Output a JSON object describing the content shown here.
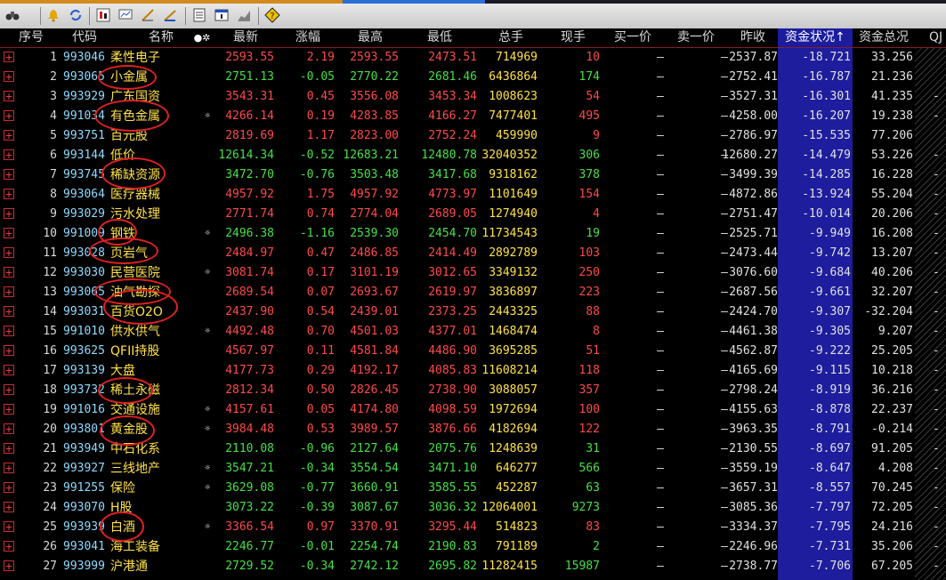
{
  "colors": {
    "accent_select": "#1d1d9e",
    "up": "#ff4a4a",
    "down": "#46e046",
    "name": "#ffe14a",
    "code": "#8fd9ff"
  },
  "toolbar": {
    "icons": [
      "binoculars-icon",
      "alarm-bell-icon",
      "sync-icon",
      "chart-candle-icon",
      "monitor-icon",
      "line-tool-icon",
      "fibonacci-icon",
      "notes-icon",
      "alert-window-icon",
      "trend-chart-icon",
      "help-diamond-icon"
    ]
  },
  "header": {
    "index": "序号",
    "code": "代码",
    "name": "名称",
    "mark": "●✲",
    "last": "最新",
    "chg": "涨幅",
    "high": "最高",
    "low": "最低",
    "vol": "总手",
    "cur": "现手",
    "bid": "买一价",
    "ask": "卖一价",
    "prev": "昨收",
    "fundstatus": "资金状况↑",
    "fundtotal": "资金总况",
    "qj": "QJ"
  },
  "rows": [
    {
      "i": "1",
      "code": "993046",
      "name": "柔性电子",
      "mark": "",
      "last": "2593.55",
      "chg": "2.19",
      "high": "2593.55",
      "low": "2473.51",
      "vol": "714969",
      "cur": "10",
      "bid": "—",
      "ask": "—",
      "prev": "2537.87",
      "fs": "-18.721",
      "ft": "33.256",
      "qj": "",
      "dir": "up"
    },
    {
      "i": "2",
      "code": "993065",
      "name": "小金属",
      "mark": "",
      "last": "2751.13",
      "chg": "-0.05",
      "high": "2770.22",
      "low": "2681.46",
      "vol": "6436864",
      "cur": "174",
      "bid": "—",
      "ask": "—",
      "prev": "2752.41",
      "fs": "-16.787",
      "ft": "21.236",
      "qj": "",
      "dir": "dn"
    },
    {
      "i": "3",
      "code": "993929",
      "name": "广东国资",
      "mark": "",
      "last": "3543.31",
      "chg": "0.45",
      "high": "3556.08",
      "low": "3453.34",
      "vol": "1008623",
      "cur": "54",
      "bid": "—",
      "ask": "—",
      "prev": "3527.31",
      "fs": "-16.301",
      "ft": "41.235",
      "qj": "-",
      "dir": "up"
    },
    {
      "i": "4",
      "code": "991034",
      "name": "有色金属",
      "mark": "☼",
      "last": "4266.14",
      "chg": "0.19",
      "high": "4283.85",
      "low": "4166.27",
      "vol": "7477401",
      "cur": "495",
      "bid": "—",
      "ask": "—",
      "prev": "4258.00",
      "fs": "-16.207",
      "ft": "19.238",
      "qj": "-",
      "dir": "up"
    },
    {
      "i": "5",
      "code": "993751",
      "name": "百元股",
      "mark": "",
      "last": "2819.69",
      "chg": "1.17",
      "high": "2823.00",
      "low": "2752.24",
      "vol": "459990",
      "cur": "9",
      "bid": "—",
      "ask": "—",
      "prev": "2786.97",
      "fs": "-15.535",
      "ft": "77.206",
      "qj": "",
      "dir": "up"
    },
    {
      "i": "6",
      "code": "993144",
      "name": "低价",
      "mark": "",
      "last": "12614.34",
      "chg": "-0.52",
      "high": "12683.21",
      "low": "12480.78",
      "vol": "32040352",
      "cur": "306",
      "bid": "—",
      "ask": "—",
      "prev": "12680.27",
      "fs": "-14.479",
      "ft": "53.226",
      "qj": "-",
      "dir": "dn"
    },
    {
      "i": "7",
      "code": "993745",
      "name": "稀缺资源",
      "mark": "",
      "last": "3472.70",
      "chg": "-0.76",
      "high": "3503.48",
      "low": "3417.68",
      "vol": "9318162",
      "cur": "378",
      "bid": "—",
      "ask": "—",
      "prev": "3499.39",
      "fs": "-14.285",
      "ft": "16.228",
      "qj": "-",
      "dir": "dn"
    },
    {
      "i": "8",
      "code": "993064",
      "name": "医疗器械",
      "mark": "",
      "last": "4957.92",
      "chg": "1.75",
      "high": "4957.92",
      "low": "4773.97",
      "vol": "1101649",
      "cur": "154",
      "bid": "—",
      "ask": "—",
      "prev": "4872.86",
      "fs": "-13.924",
      "ft": "55.204",
      "qj": "-",
      "dir": "up"
    },
    {
      "i": "9",
      "code": "993029",
      "name": "污水处理",
      "mark": "",
      "last": "2771.74",
      "chg": "0.74",
      "high": "2774.04",
      "low": "2689.05",
      "vol": "1274940",
      "cur": "4",
      "bid": "—",
      "ask": "—",
      "prev": "2751.47",
      "fs": "-10.014",
      "ft": "20.206",
      "qj": "-",
      "dir": "up"
    },
    {
      "i": "10",
      "code": "991009",
      "name": "钢铁",
      "mark": "☼",
      "last": "2496.38",
      "chg": "-1.16",
      "high": "2539.30",
      "low": "2454.70",
      "vol": "11734543",
      "cur": "19",
      "bid": "—",
      "ask": "—",
      "prev": "2525.71",
      "fs": "-9.949",
      "ft": "16.208",
      "qj": "-",
      "dir": "dn"
    },
    {
      "i": "11",
      "code": "993028",
      "name": "页岩气",
      "mark": "",
      "last": "2484.97",
      "chg": "0.47",
      "high": "2486.85",
      "low": "2414.49",
      "vol": "2892789",
      "cur": "103",
      "bid": "—",
      "ask": "—",
      "prev": "2473.44",
      "fs": "-9.742",
      "ft": "13.207",
      "qj": "-",
      "dir": "up"
    },
    {
      "i": "12",
      "code": "993030",
      "name": "民营医院",
      "mark": "☼",
      "last": "3081.74",
      "chg": "0.17",
      "high": "3101.19",
      "low": "3012.65",
      "vol": "3349132",
      "cur": "250",
      "bid": "—",
      "ask": "—",
      "prev": "3076.60",
      "fs": "-9.684",
      "ft": "40.206",
      "qj": "-",
      "dir": "up"
    },
    {
      "i": "13",
      "code": "993065",
      "name": "油气勘探",
      "mark": "",
      "last": "2689.54",
      "chg": "0.07",
      "high": "2693.67",
      "low": "2619.97",
      "vol": "3836897",
      "cur": "223",
      "bid": "—",
      "ask": "—",
      "prev": "2687.56",
      "fs": "-9.661",
      "ft": "32.207",
      "qj": "-",
      "dir": "up"
    },
    {
      "i": "14",
      "code": "993031",
      "name": "百货O2O",
      "mark": "",
      "last": "2437.90",
      "chg": "0.54",
      "high": "2439.01",
      "low": "2373.25",
      "vol": "2443325",
      "cur": "88",
      "bid": "—",
      "ask": "—",
      "prev": "2424.70",
      "fs": "-9.307",
      "ft": "-32.204",
      "qj": "-",
      "dir": "up"
    },
    {
      "i": "15",
      "code": "991010",
      "name": "供水供气",
      "mark": "☼",
      "last": "4492.48",
      "chg": "0.70",
      "high": "4501.03",
      "low": "4377.01",
      "vol": "1468474",
      "cur": "8",
      "bid": "—",
      "ask": "—",
      "prev": "4461.38",
      "fs": "-9.305",
      "ft": "9.207",
      "qj": "-",
      "dir": "up"
    },
    {
      "i": "16",
      "code": "993625",
      "name": "QFII持股",
      "mark": "",
      "last": "4567.97",
      "chg": "0.11",
      "high": "4581.84",
      "low": "4486.90",
      "vol": "3695285",
      "cur": "51",
      "bid": "—",
      "ask": "—",
      "prev": "4562.87",
      "fs": "-9.222",
      "ft": "25.205",
      "qj": "-",
      "dir": "up"
    },
    {
      "i": "17",
      "code": "993139",
      "name": "大盘",
      "mark": "",
      "last": "4177.73",
      "chg": "0.29",
      "high": "4192.17",
      "low": "4085.83",
      "vol": "11608214",
      "cur": "118",
      "bid": "—",
      "ask": "—",
      "prev": "4165.69",
      "fs": "-9.115",
      "ft": "10.218",
      "qj": "-",
      "dir": "up"
    },
    {
      "i": "18",
      "code": "993732",
      "name": "稀土永磁",
      "mark": "",
      "last": "2812.34",
      "chg": "0.50",
      "high": "2826.45",
      "low": "2738.90",
      "vol": "3088057",
      "cur": "357",
      "bid": "—",
      "ask": "—",
      "prev": "2798.24",
      "fs": "-8.919",
      "ft": "36.216",
      "qj": "-",
      "dir": "up"
    },
    {
      "i": "19",
      "code": "991016",
      "name": "交通设施",
      "mark": "☼",
      "last": "4157.61",
      "chg": "0.05",
      "high": "4174.80",
      "low": "4098.59",
      "vol": "1972694",
      "cur": "100",
      "bid": "—",
      "ask": "—",
      "prev": "4155.63",
      "fs": "-8.878",
      "ft": "22.237",
      "qj": "-",
      "dir": "up"
    },
    {
      "i": "20",
      "code": "993801",
      "name": "黄金股",
      "mark": "☼",
      "last": "3984.48",
      "chg": "0.53",
      "high": "3989.57",
      "low": "3876.66",
      "vol": "4182694",
      "cur": "122",
      "bid": "—",
      "ask": "—",
      "prev": "3963.35",
      "fs": "-8.791",
      "ft": "-0.214",
      "qj": "-",
      "dir": "up"
    },
    {
      "i": "21",
      "code": "993949",
      "name": "中石化系",
      "mark": "",
      "last": "2110.08",
      "chg": "-0.96",
      "high": "2127.64",
      "low": "2075.76",
      "vol": "1248639",
      "cur": "31",
      "bid": "—",
      "ask": "—",
      "prev": "2130.55",
      "fs": "-8.697",
      "ft": "91.205",
      "qj": "-",
      "dir": "dn"
    },
    {
      "i": "22",
      "code": "993927",
      "name": "三线地产",
      "mark": "☼",
      "last": "3547.21",
      "chg": "-0.34",
      "high": "3554.54",
      "low": "3471.10",
      "vol": "646277",
      "cur": "566",
      "bid": "—",
      "ask": "—",
      "prev": "3559.19",
      "fs": "-8.647",
      "ft": "4.208",
      "qj": "-",
      "dir": "dn"
    },
    {
      "i": "23",
      "code": "991255",
      "name": "保险",
      "mark": "☼",
      "last": "3629.08",
      "chg": "-0.77",
      "high": "3660.91",
      "low": "3585.55",
      "vol": "452287",
      "cur": "63",
      "bid": "—",
      "ask": "—",
      "prev": "3657.31",
      "fs": "-8.557",
      "ft": "70.245",
      "qj": "-",
      "dir": "dn"
    },
    {
      "i": "24",
      "code": "993070",
      "name": "H股",
      "mark": "",
      "last": "3073.22",
      "chg": "-0.39",
      "high": "3087.67",
      "low": "3036.32",
      "vol": "12064001",
      "cur": "9273",
      "bid": "—",
      "ask": "—",
      "prev": "3085.36",
      "fs": "-7.797",
      "ft": "72.205",
      "qj": "-",
      "dir": "dn"
    },
    {
      "i": "25",
      "code": "993939",
      "name": "白酒",
      "mark": "☼",
      "last": "3366.54",
      "chg": "0.97",
      "high": "3370.91",
      "low": "3295.44",
      "vol": "514823",
      "cur": "83",
      "bid": "—",
      "ask": "—",
      "prev": "3334.37",
      "fs": "-7.795",
      "ft": "24.216",
      "qj": "-",
      "dir": "up"
    },
    {
      "i": "26",
      "code": "993041",
      "name": "海工装备",
      "mark": "",
      "last": "2246.77",
      "chg": "-0.01",
      "high": "2254.74",
      "low": "2190.83",
      "vol": "791189",
      "cur": "2",
      "bid": "—",
      "ask": "—",
      "prev": "2246.96",
      "fs": "-7.731",
      "ft": "35.206",
      "qj": "-",
      "dir": "dn"
    },
    {
      "i": "27",
      "code": "993999",
      "name": "沪港通",
      "mark": "",
      "last": "2729.52",
      "chg": "-0.34",
      "high": "2742.12",
      "low": "2695.82",
      "vol": "11282415",
      "cur": "15987",
      "bid": "—",
      "ask": "—",
      "prev": "2738.77",
      "fs": "-7.706",
      "ft": "67.205",
      "qj": "-",
      "dir": "dn"
    }
  ]
}
